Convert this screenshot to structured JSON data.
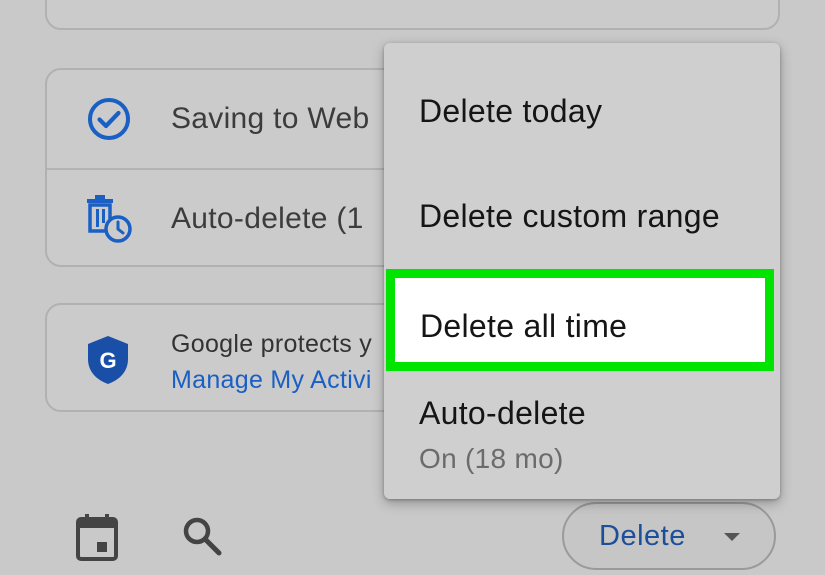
{
  "settings": {
    "saving_label": "Saving to Web",
    "autodelete_label": "Auto-delete (1"
  },
  "protect": {
    "line1": "Google protects y",
    "link": "Manage My Activi"
  },
  "bottom_bar": {
    "delete_label": "Delete"
  },
  "menu": {
    "items": [
      {
        "label": "Delete today"
      },
      {
        "label": "Delete custom range"
      },
      {
        "label": "Delete all time",
        "highlighted": true
      },
      {
        "label": "Auto-delete",
        "sublabel": "On (18 mo)"
      }
    ]
  },
  "colors": {
    "accent_blue": "#1a5fc4",
    "highlight_green": "#00e400",
    "background": "#c9c9c9"
  },
  "icons": {
    "saving": "check-circle-icon",
    "autodelete": "trash-clock-icon",
    "protect": "google-shield-icon",
    "calendar": "calendar-icon",
    "search": "search-icon",
    "dropdown": "caret-down-icon"
  }
}
